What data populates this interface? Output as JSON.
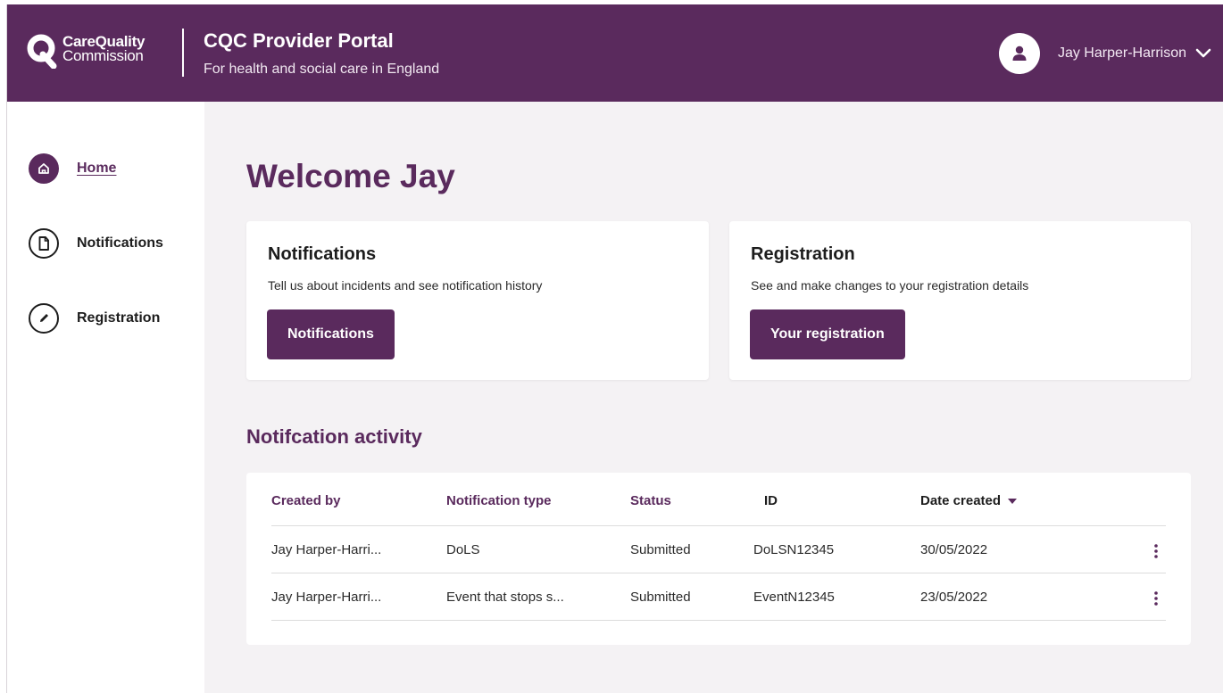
{
  "header": {
    "logo_line1": "CareQuality",
    "logo_line2": "Commission",
    "title": "CQC Provider Portal",
    "subtitle": "For health and social care in England",
    "user_name": "Jay Harper-Harrison"
  },
  "sidebar": {
    "items": [
      {
        "label": "Home",
        "icon": "home-icon",
        "active": true
      },
      {
        "label": "Notifications",
        "icon": "document-icon",
        "active": false
      },
      {
        "label": "Registration",
        "icon": "pencil-icon",
        "active": false
      }
    ]
  },
  "main": {
    "welcome": "Welcome Jay",
    "cards": [
      {
        "title": "Notifications",
        "description": "Tell us about incidents and see notification history",
        "button": "Notifications"
      },
      {
        "title": "Registration",
        "description": "See and make changes to your registration details",
        "button": "Your registration"
      }
    ],
    "activity": {
      "title": "Notifcation activity",
      "columns": [
        "Created by",
        "Notification type",
        "Status",
        "ID",
        "Date created"
      ],
      "rows": [
        [
          "Jay Harper-Harri...",
          "DoLS",
          "Submitted",
          "DoLSN12345",
          "30/05/2022"
        ],
        [
          "Jay Harper-Harri...",
          "Event that stops s...",
          "Submitted",
          "EventN12345",
          "23/05/2022"
        ]
      ]
    }
  },
  "colors": {
    "brand": "#5a2a5d",
    "background": "#f4f2f4"
  }
}
